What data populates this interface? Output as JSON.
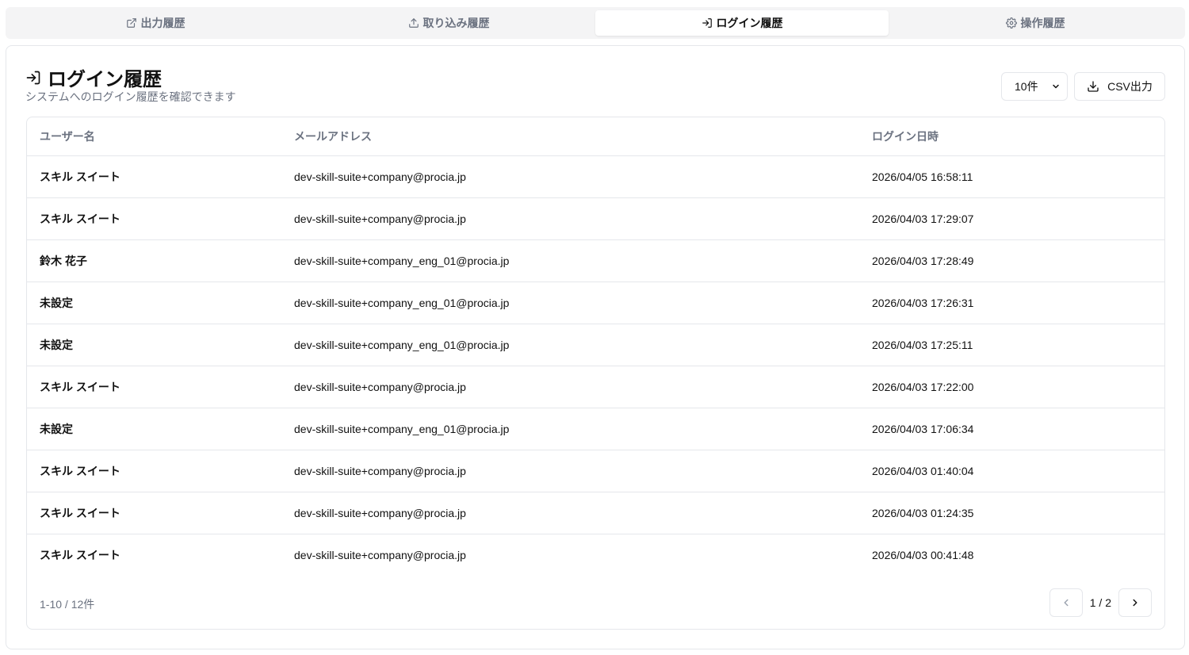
{
  "tabs": [
    {
      "label": "出力履歴",
      "icon": "external-link-icon",
      "active": false
    },
    {
      "label": "取り込み履歴",
      "icon": "upload-icon",
      "active": false
    },
    {
      "label": "ログイン履歴",
      "icon": "login-icon",
      "active": true
    },
    {
      "label": "操作履歴",
      "icon": "gear-icon",
      "active": false
    }
  ],
  "header": {
    "title": "ログイン履歴",
    "subtitle": "システムへのログイン履歴を確認できます",
    "page_size_select": "10件",
    "csv_label": "CSV出力"
  },
  "table": {
    "columns": [
      "ユーザー名",
      "メールアドレス",
      "ログイン日時"
    ],
    "rows": [
      {
        "name": "スキル スイート",
        "email": "dev-skill-suite+company@procia.jp",
        "datetime": "2026/04/05 16:58:11"
      },
      {
        "name": "スキル スイート",
        "email": "dev-skill-suite+company@procia.jp",
        "datetime": "2026/04/03 17:29:07"
      },
      {
        "name": "鈴木 花子",
        "email": "dev-skill-suite+company_eng_01@procia.jp",
        "datetime": "2026/04/03 17:28:49"
      },
      {
        "name": "未設定",
        "email": "dev-skill-suite+company_eng_01@procia.jp",
        "datetime": "2026/04/03 17:26:31"
      },
      {
        "name": "未設定",
        "email": "dev-skill-suite+company_eng_01@procia.jp",
        "datetime": "2026/04/03 17:25:11"
      },
      {
        "name": "スキル スイート",
        "email": "dev-skill-suite+company@procia.jp",
        "datetime": "2026/04/03 17:22:00"
      },
      {
        "name": "未設定",
        "email": "dev-skill-suite+company_eng_01@procia.jp",
        "datetime": "2026/04/03 17:06:34"
      },
      {
        "name": "スキル スイート",
        "email": "dev-skill-suite+company@procia.jp",
        "datetime": "2026/04/03 01:40:04"
      },
      {
        "name": "スキル スイート",
        "email": "dev-skill-suite+company@procia.jp",
        "datetime": "2026/04/03 01:24:35"
      },
      {
        "name": "スキル スイート",
        "email": "dev-skill-suite+company@procia.jp",
        "datetime": "2026/04/03 00:41:48"
      }
    ]
  },
  "footer": {
    "range": "1-10 / 12件",
    "page": "1 / 2"
  }
}
